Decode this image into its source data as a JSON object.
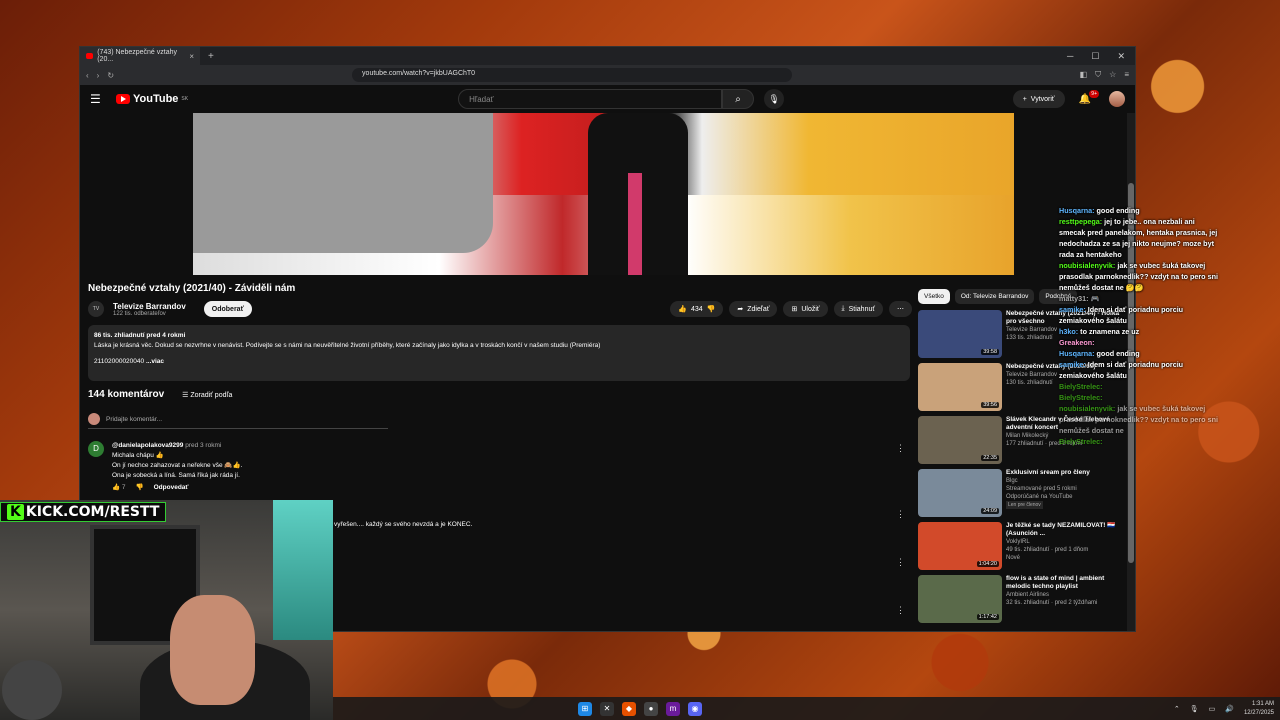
{
  "browser": {
    "tab_title": "(743) Nebezpečné vztahy (20...",
    "url": "youtube.com/watch?v=jkbUAGChT0"
  },
  "youtube": {
    "logo": "YouTube",
    "logo_sup": "SK",
    "search_placeholder": "Hľadať",
    "create_label": "Vytvoriť",
    "notif_badge": "9+"
  },
  "video": {
    "title": "Nebezpečné vztahy (2021/40) - Záviděli nám",
    "channel": "Televize Barrandov",
    "channel_avatar": "TV",
    "subs": "122 tis. odberateľov",
    "subscribe": "Odoberať",
    "likes": "434",
    "share": "Zdieľať",
    "save": "Uložiť",
    "download": "Stiahnuť",
    "desc_meta": "86 tis. zhliadnutí  pred 4 rokmi",
    "desc_text": "Láska je krásná věc. Dokud se nezvrhne v nenávist. Podívejte se s námi na neuvěřitelné životní příběhy, které začínaly jako idylka a v troskách končí v našem studiu (Premiéra)",
    "desc_id": "21102000020040",
    "desc_more": "...viac"
  },
  "comments": {
    "count": "144 komentárov",
    "sort": "Zoradiť podľa",
    "add_placeholder": "Pridajte komentár...",
    "first": {
      "avatar": "D",
      "author": "@danielapolakova9299",
      "time": "pred 3 rokmi",
      "line1": "Michala chápu 👍",
      "line2": "On jí nechce zahazovat a neřekne vše 🙈👍.",
      "line3": "Ona je sobecká a líná. Samá říká jak ráda jí.",
      "likes": "7",
      "reply": "Odpovedať"
    },
    "second_text": "vyřešen.... každý se svého nevzdá a je KONEC."
  },
  "related": {
    "chips": [
      "Všetko",
      "Od: Televize Barrandov",
      "Podobné"
    ],
    "items": [
      {
        "title": "Nebezpečné vztahy (2021/44) - Holka pro všechno",
        "channel": "Televize Barrandov",
        "meta": "133 tis. zhliadnutí",
        "dur": "39:58",
        "color": "#3a4a7a"
      },
      {
        "title": "Nebezpečné vztahy (2020/61)",
        "channel": "Televize Barrandov",
        "meta": "130 tis. zhliadnutí",
        "dur": "39:56",
        "color": "#c9a27a"
      },
      {
        "title": "Slávek Klecandr v České Třebové  adventní koncert",
        "channel": "Milan Mikolecký",
        "meta": "177 zhliadnutí · pred 2 rokmi",
        "dur": "22:35",
        "color": "#6b6250"
      },
      {
        "title": "Exklusivní sream pro členy",
        "channel": "Blgc",
        "meta": "Streamované pred 5 rokmi",
        "extra": "Odporúčané na YouTube",
        "extra2": "Len pre členov",
        "dur": "24:09",
        "color": "#7a8a9a"
      },
      {
        "title": "Je těžké se tady NEZAMILOVAT! 🇵🇾 (Asunción ...",
        "channel": "VoklyIRL",
        "meta": "49 tis. zhliadnutí · pred 1 dňom",
        "extra": "Nové",
        "dur": "1:04:20",
        "color": "#d24a2a"
      },
      {
        "title": "flow is a state of mind | ambient melodic techno playlist",
        "channel": "Ambient Airlines",
        "meta": "32 tis. zhliadnutí · pred 2 týždňami",
        "dur": "1:17:42",
        "color": "#5a6a4a"
      }
    ]
  },
  "chat": [
    {
      "user": "Husqarna:",
      "color": "#5fb6ff",
      "text": "good ending"
    },
    {
      "user": "resttpepega:",
      "color": "#53fc18",
      "text": "jej to jebe.. ona nezbali ani smecak pred panelakom, hentaka prasnica, jej nedochadza ze sa jej nikto neujme? moze byt rada za hentakeho"
    },
    {
      "user": "noubisialenyvik:",
      "color": "#53fc18",
      "text": "jak se vubec šuká takovej prasodlak parnoknedlik?? vzdyt na to pero sni nemůžeš dostat ne 🤔🤔"
    },
    {
      "user": "matty31:",
      "color": "#aaaaaa",
      "text": "🎮"
    },
    {
      "user": "samike:",
      "color": "#5fb6ff",
      "text": "Idem si dať poriadnu porciu zemiakového šalátu"
    },
    {
      "user": "h3ko:",
      "color": "#5fb6ff",
      "text": "to znamena ze uz"
    },
    {
      "user": "Greakeon:",
      "color": "#ff9bd4",
      "text": ""
    },
    {
      "user": "Husqarna:",
      "color": "#5fb6ff",
      "text": "good ending"
    },
    {
      "user": "samike:",
      "color": "#5fb6ff",
      "text": "Idem si dať poriadnu porciu zemiakového šalátu"
    },
    {
      "user": "BielyStrelec:",
      "color": "#53fc18",
      "text": ""
    },
    {
      "user": "BielyStrelec:",
      "color": "#53fc18",
      "text": ""
    },
    {
      "user": "noubisialenyvik:",
      "color": "#53fc18",
      "text": "jak se vubec šuká takovej prasodlak parnoknedlik?? vzdyt na to pero sni nemůžeš dostat ne"
    },
    {
      "user": "BielyStrelec:",
      "color": "#53fc18",
      "text": ""
    }
  ],
  "overlay": {
    "kick_k": "K",
    "kick_text": "KICK.COM/RESTT"
  },
  "taskbar": {
    "time": "1:31 AM",
    "date": "12/27/2025"
  }
}
